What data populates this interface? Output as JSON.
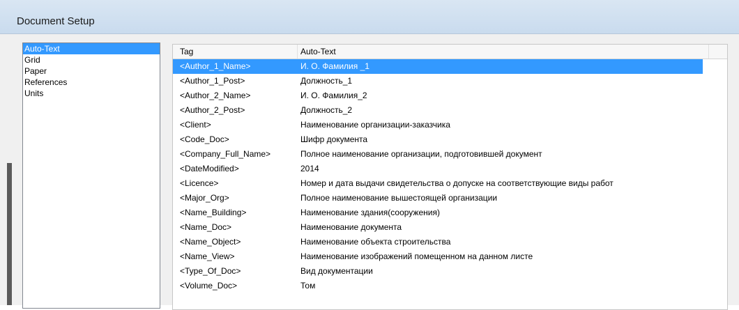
{
  "window": {
    "title": "Document Setup"
  },
  "sidebar": {
    "items": [
      {
        "label": "Auto-Text",
        "selected": true
      },
      {
        "label": "Grid",
        "selected": false
      },
      {
        "label": "Paper",
        "selected": false
      },
      {
        "label": "References",
        "selected": false
      },
      {
        "label": "Units",
        "selected": false
      }
    ]
  },
  "table": {
    "columns": [
      "Tag",
      "Auto-Text"
    ],
    "rows": [
      {
        "tag": "<Author_1_Name>",
        "value": "И. О. Фамилия _1",
        "selected": true
      },
      {
        "tag": "<Author_1_Post>",
        "value": "Должность_1"
      },
      {
        "tag": "<Author_2_Name>",
        "value": "И. О. Фамилия_2"
      },
      {
        "tag": "<Author_2_Post>",
        "value": "Должность_2"
      },
      {
        "tag": "<Client>",
        "value": "Наименование организации-заказчика"
      },
      {
        "tag": "<Code_Doc>",
        "value": "Шифр документа"
      },
      {
        "tag": "<Company_Full_Name>",
        "value": "Полное наименование организации, подготовившей документ"
      },
      {
        "tag": "<DateModified>",
        "value": "2014"
      },
      {
        "tag": "<Licence>",
        "value": "Номер и дата выдачи свидетельства о допуске на соответствующие виды работ"
      },
      {
        "tag": "<Major_Org>",
        "value": "Полное наименование вышестоящей организации"
      },
      {
        "tag": "<Name_Building>",
        "value": "Наименование здания(сооружения)"
      },
      {
        "tag": "<Name_Doc>",
        "value": "Наименование документа"
      },
      {
        "tag": "<Name_Object>",
        "value": "Наименование объекта строительства"
      },
      {
        "tag": "<Name_View>",
        "value": "Наименование изображений помещенном на данном листе"
      },
      {
        "tag": "<Type_Of_Doc>",
        "value": "Вид документации"
      },
      {
        "tag": "<Volume_Doc>",
        "value": "Том"
      }
    ]
  },
  "colors": {
    "selection": "#3399ff",
    "titlebar": "#c9dbee"
  }
}
